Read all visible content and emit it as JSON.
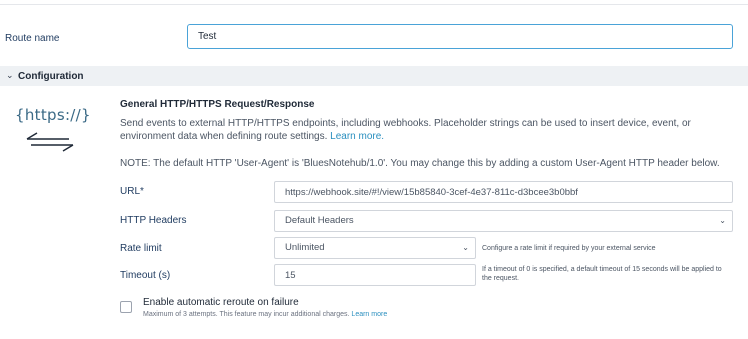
{
  "route": {
    "label": "Route name",
    "value": "Test"
  },
  "configuration": {
    "title": "Configuration"
  },
  "logo": {
    "text": "{https://}"
  },
  "section": {
    "title": "General HTTP/HTTPS Request/Response",
    "description": "Send events to external HTTP/HTTPS endpoints, including webhooks. Placeholder strings can be used to insert device, event, or environment data when defining route settings.",
    "learn_more": "Learn more.",
    "note": "NOTE: The default HTTP 'User-Agent' is 'BluesNotehub/1.0'. You may change this by adding a custom User-Agent HTTP header below."
  },
  "fields": {
    "url": {
      "label": "URL*",
      "value": "https://webhook.site/#!/view/15b85840-3cef-4e37-811c-d3bcee3b0bbf"
    },
    "headers": {
      "label": "HTTP Headers",
      "value": "Default Headers"
    },
    "rate_limit": {
      "label": "Rate limit",
      "value": "Unlimited",
      "hint": "Configure a rate limit if required by your external service"
    },
    "timeout": {
      "label": "Timeout (s)",
      "value": "15",
      "hint": "If a timeout of 0 is specified, a default timeout of 15 seconds will be applied to the request."
    }
  },
  "reroute": {
    "label": "Enable automatic reroute on failure",
    "sub": "Maximum of 3 attempts. This feature may incur additional charges.",
    "learn_more": "Learn more",
    "checked": false
  }
}
